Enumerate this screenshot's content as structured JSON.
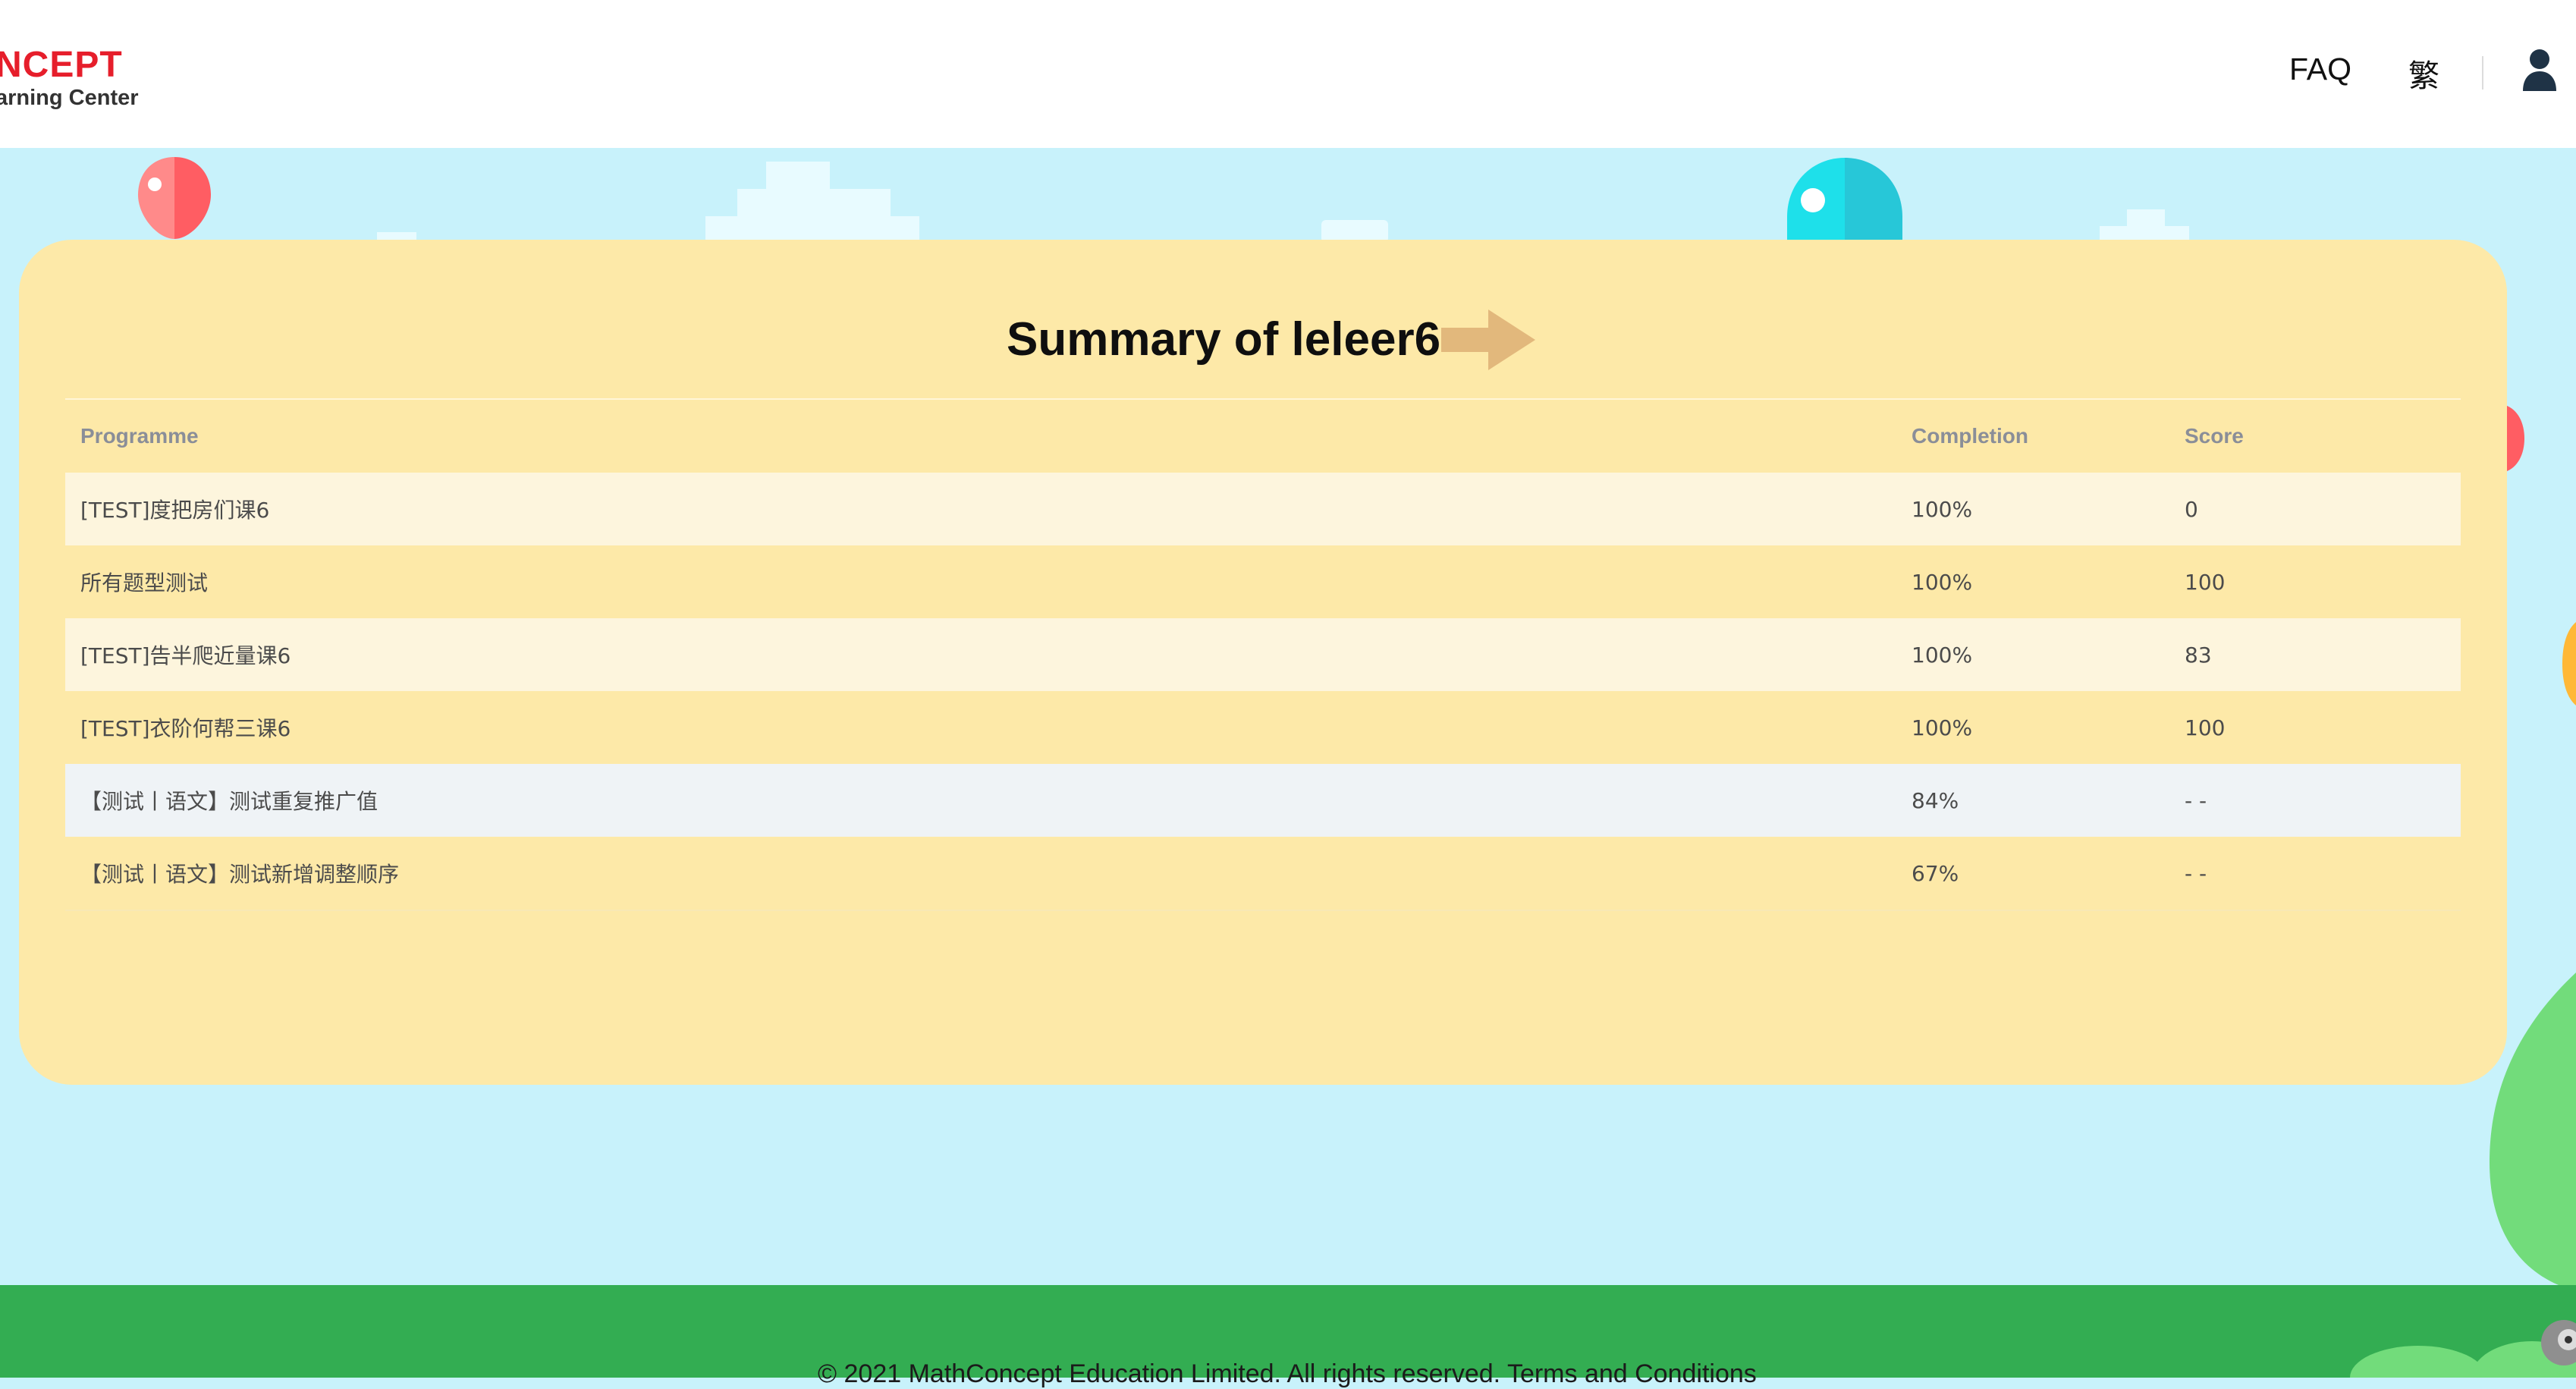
{
  "header": {
    "logo_line1": "NCEPT",
    "logo_line2": "arning Center",
    "nav": {
      "faq": "FAQ",
      "language": "繁"
    },
    "user_icon": "user-icon"
  },
  "summary": {
    "title": "Summary of leleer6",
    "arrow_icon": "arrow-right-icon",
    "columns": {
      "programme": "Programme",
      "completion": "Completion",
      "score": "Score"
    },
    "rows": [
      {
        "programme": "[TEST]度把房们课6",
        "completion": "100%",
        "score": "0"
      },
      {
        "programme": "所有题型测试",
        "completion": "100%",
        "score": "100"
      },
      {
        "programme": "[TEST]告半爬近量课6",
        "completion": "100%",
        "score": "83"
      },
      {
        "programme": "[TEST]衣阶何帮三课6",
        "completion": "100%",
        "score": "100"
      },
      {
        "programme": "【测试丨语文】测试重复推广值",
        "completion": "84%",
        "score": "- -"
      },
      {
        "programme": "【测试丨语文】测试新增调整顺序",
        "completion": "67%",
        "score": "- -"
      }
    ]
  },
  "footer": {
    "copyright": "© 2021 MathConcept Education Limited. All rights reserved.",
    "terms_link": "Terms and Conditions"
  },
  "colors": {
    "background_sky": "#c8f2fb",
    "card": "#fde9a8",
    "footer_green": "#33ad52",
    "arrow": "#e2b87c",
    "logo_red": "#e61e2b"
  }
}
